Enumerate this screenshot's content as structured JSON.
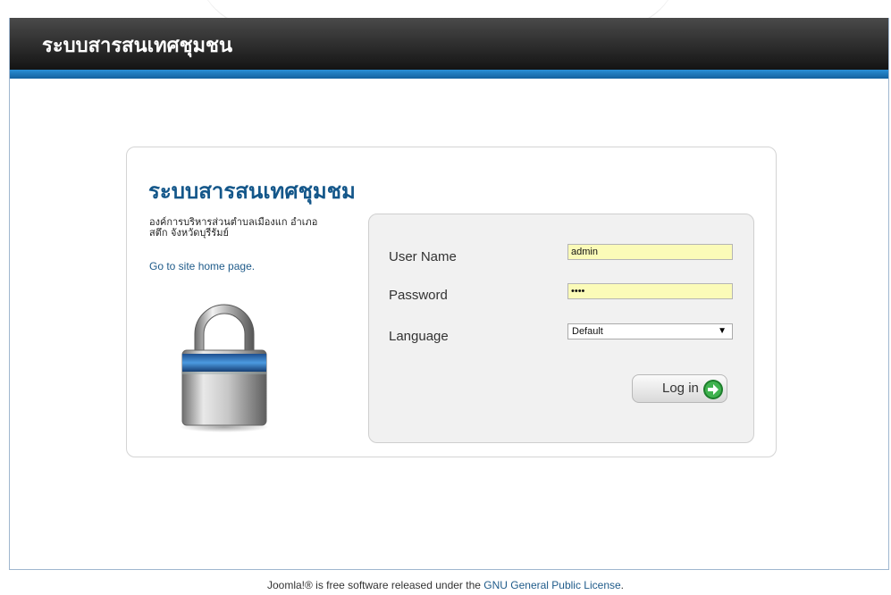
{
  "header": {
    "title": "ระบบสารสนเทศชุมชน"
  },
  "login_box": {
    "title": "ระบบสารสนเทศชุมชม",
    "org_line1": "องค์การบริหารส่วนตำบลเมืองแก อำเภอ",
    "org_line2": "สตึก จังหวัดบุรีรัมย์",
    "home_link": "Go to site home page."
  },
  "form": {
    "username_label": "User Name",
    "username_value": "admin",
    "password_label": "Password",
    "password_value": "••••",
    "language_label": "Language",
    "language_value": "Default",
    "login_button": "Log in"
  },
  "footer": {
    "brand": "Joomla!®",
    "text": " is free software released under the ",
    "license_link": "GNU General Public License",
    "period": "."
  },
  "colors": {
    "header_dark": "#141414",
    "header_stripe": "#1b78c2",
    "title_blue": "#14578a",
    "input_yellow": "#fbfbb8",
    "button_arrow_green": "#2e9e3c"
  },
  "icons": {
    "lock": "padlock-icon",
    "login_arrow": "arrow-right-circle-icon",
    "dropdown": "triangle-down-icon"
  }
}
